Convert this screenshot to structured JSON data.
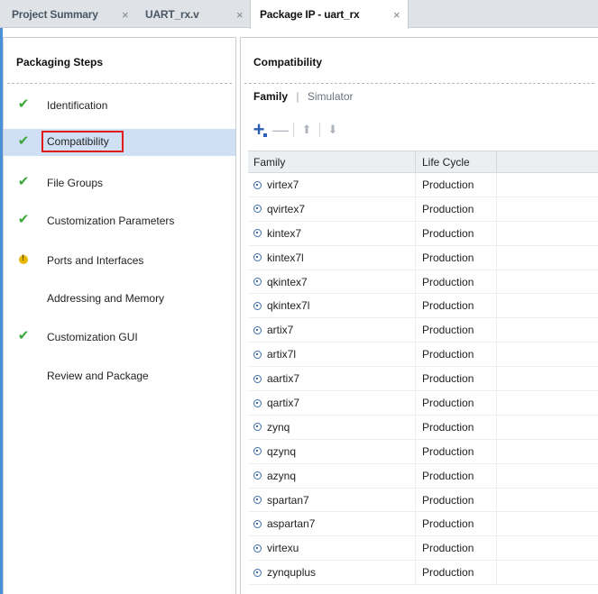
{
  "tabs": [
    {
      "label": "Project Summary",
      "active": false
    },
    {
      "label": "UART_rx.v",
      "active": false
    },
    {
      "label": "Package IP - uart_rx",
      "active": true
    }
  ],
  "close_glyph": "×",
  "left_panel": {
    "title": "Packaging Steps",
    "steps": [
      {
        "label": "Identification",
        "status": "check-icon"
      },
      {
        "label": "Compatibility",
        "status": "check-icon",
        "selected": true
      },
      {
        "label": "File Groups",
        "status": "check-icon"
      },
      {
        "label": "Customization Parameters",
        "status": "check-icon"
      },
      {
        "label": "Ports and Interfaces",
        "status": "warning-icon"
      },
      {
        "label": "Addressing and Memory",
        "status": "none"
      },
      {
        "label": "Customization GUI",
        "status": "check-icon"
      },
      {
        "label": "Review and Package",
        "status": "none"
      }
    ]
  },
  "right_panel": {
    "title": "Compatibility",
    "subtabs": {
      "active": "Family",
      "separator": "|",
      "other": "Simulator"
    },
    "toolbar": {
      "add": "+",
      "remove": "—",
      "up": "⬆",
      "down": "⬇"
    },
    "columns": {
      "family": "Family",
      "life_cycle": "Life Cycle"
    },
    "rows": [
      {
        "family": "virtex7",
        "life": "Production"
      },
      {
        "family": "qvirtex7",
        "life": "Production"
      },
      {
        "family": "kintex7",
        "life": "Production"
      },
      {
        "family": "kintex7l",
        "life": "Production"
      },
      {
        "family": "qkintex7",
        "life": "Production"
      },
      {
        "family": "qkintex7l",
        "life": "Production"
      },
      {
        "family": "artix7",
        "life": "Production"
      },
      {
        "family": "artix7l",
        "life": "Production"
      },
      {
        "family": "aartix7",
        "life": "Production"
      },
      {
        "family": "qartix7",
        "life": "Production"
      },
      {
        "family": "zynq",
        "life": "Production"
      },
      {
        "family": "qzynq",
        "life": "Production"
      },
      {
        "family": "azynq",
        "life": "Production"
      },
      {
        "family": "spartan7",
        "life": "Production"
      },
      {
        "family": "aspartan7",
        "life": "Production"
      },
      {
        "family": "virtexu",
        "life": "Production"
      },
      {
        "family": "zynquplus",
        "life": "Production"
      }
    ]
  },
  "colors": {
    "accent": "#2b5fb3",
    "check": "#3aa83a",
    "warning": "#e8b800",
    "selected_row": "#cfe0f5",
    "highlight_box": "#e01919"
  }
}
